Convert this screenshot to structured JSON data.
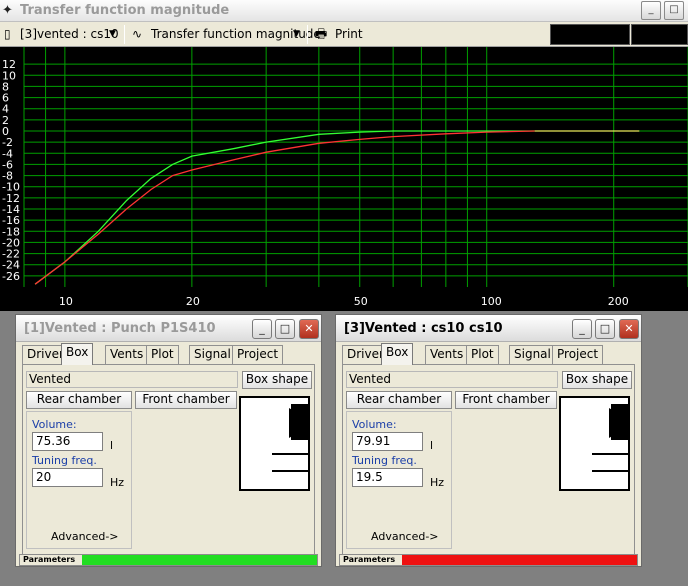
{
  "window": {
    "title": "Transfer function magnitude",
    "buttons": {
      "minimize": "_",
      "maximize": "□"
    }
  },
  "toolbar": {
    "system_selector": "[3]vented : cs10",
    "graph_selector": "Transfer function magnitude",
    "print_label": "Print"
  },
  "chart_data": {
    "type": "line",
    "x_scale": "log",
    "xlim": [
      8,
      300
    ],
    "ylim": [
      -28,
      14
    ],
    "x_ticks": [
      10,
      20,
      50,
      100,
      200
    ],
    "x_tick_labels": [
      "10",
      "20",
      "50",
      "100",
      "200"
    ],
    "y_ticks": [
      12,
      10,
      8,
      6,
      4,
      2,
      0,
      -2,
      -4,
      -6,
      -8,
      -10,
      -12,
      -14,
      -16,
      -18,
      -20,
      -22,
      -24,
      -26
    ],
    "y_tick_labels": [
      "12",
      "10",
      "8",
      "6",
      "4",
      "2",
      "0",
      "-2",
      "-4",
      "-6",
      "-8",
      "-10",
      "-12",
      "-14",
      "-16",
      "-18",
      "-20",
      "-22",
      "-24",
      "-26"
    ],
    "background": "#000000",
    "grid": true,
    "grid_color": "#00a000",
    "series": [
      {
        "color": "#33ff33",
        "x": [
          8.5,
          10,
          12,
          14,
          16,
          18,
          20,
          25,
          30,
          40,
          50,
          60,
          80,
          100,
          130
        ],
        "y": [
          -27.5,
          -23.5,
          -18,
          -12.5,
          -8.5,
          -6,
          -4.5,
          -3.2,
          -2,
          -0.6,
          -0.2,
          0,
          0,
          0,
          0
        ]
      },
      {
        "color": "#ff3333",
        "x": [
          8.5,
          10,
          12,
          14,
          16,
          18,
          20,
          25,
          30,
          40,
          50,
          60,
          80,
          100,
          130
        ],
        "y": [
          -27.5,
          -23.5,
          -18.5,
          -14,
          -10.5,
          -8,
          -7,
          -5.2,
          -3.8,
          -2.2,
          -1.5,
          -1,
          -0.5,
          -0.2,
          0
        ]
      },
      {
        "color": "#e8e85a",
        "x": [
          130,
          160,
          200,
          230
        ],
        "y": [
          0,
          0,
          0,
          0
        ]
      }
    ]
  },
  "windows": [
    {
      "title": "[1]Vented : Punch P1S410",
      "active": false,
      "tabs": [
        "Driver",
        "Box",
        "Vents",
        "Plot",
        "Signal",
        "Project"
      ],
      "active_tab": "Box",
      "box_type": "Vented",
      "box_shape_button": "Box shape",
      "rear_chamber_button": "Rear chamber",
      "front_chamber_button": "Front chamber",
      "volume_label": "Volume:",
      "volume_value": "75.36",
      "volume_unit": "l",
      "tuning_label": "Tuning freq.",
      "tuning_value": "20",
      "tuning_unit": "Hz",
      "advanced_label": "Advanced->",
      "status_label": "Parameters",
      "status_color": "#22dd22"
    },
    {
      "title": "[3]Vented : cs10 cs10",
      "active": true,
      "tabs": [
        "Driver",
        "Box",
        "Vents",
        "Plot",
        "Signal",
        "Project"
      ],
      "active_tab": "Box",
      "box_type": "Vented",
      "box_shape_button": "Box shape",
      "rear_chamber_button": "Rear chamber",
      "front_chamber_button": "Front chamber",
      "volume_label": "Volume:",
      "volume_value": "79.91",
      "volume_unit": "l",
      "tuning_label": "Tuning freq.",
      "tuning_value": "19.5",
      "tuning_unit": "Hz",
      "advanced_label": "Advanced->",
      "status_label": "Parameters",
      "status_color": "#ee1111"
    }
  ]
}
